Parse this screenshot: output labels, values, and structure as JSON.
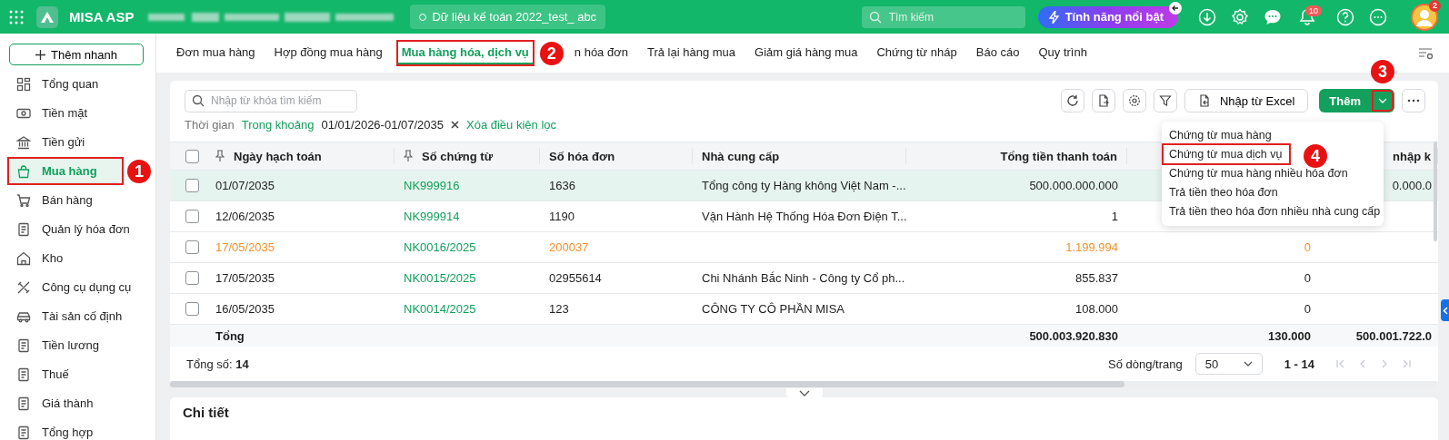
{
  "topbar": {
    "app_name": "MISA ASP",
    "database": "Dữ liệu kế toán 2022_test_ abc",
    "search": {
      "placeholder": "Tìm kiếm"
    },
    "feature_button": "Tính năng nổi bật",
    "notification_count": "10",
    "avatar_badge": "2"
  },
  "sidebar": {
    "quick_add": "Thêm nhanh",
    "items": [
      {
        "label": "Tổng quan",
        "selected": false
      },
      {
        "label": "Tiền mặt",
        "selected": false
      },
      {
        "label": "Tiền gửi",
        "selected": false
      },
      {
        "label": "Mua hàng",
        "selected": true,
        "callout": "1"
      },
      {
        "label": "Bán hàng",
        "selected": false
      },
      {
        "label": "Quản lý hóa đơn",
        "selected": false
      },
      {
        "label": "Kho",
        "selected": false
      },
      {
        "label": "Công cụ dụng cụ",
        "selected": false
      },
      {
        "label": "Tài sản cố định",
        "selected": false
      },
      {
        "label": "Tiền lương",
        "selected": false
      },
      {
        "label": "Thuế",
        "selected": false
      },
      {
        "label": "Giá thành",
        "selected": false
      },
      {
        "label": "Tổng hợp",
        "selected": false
      }
    ]
  },
  "tabs": [
    {
      "label": "Đơn mua hàng",
      "selected": false
    },
    {
      "label": "Hợp đồng mua hàng",
      "selected": false
    },
    {
      "label": "Mua hàng hóa, dịch vụ",
      "selected": true,
      "callout": "2"
    },
    {
      "label": "n hóa đơn",
      "selected": false
    },
    {
      "label": "Trả lại hàng mua",
      "selected": false
    },
    {
      "label": "Giảm giá hàng mua",
      "selected": false
    },
    {
      "label": "Chứng từ nháp",
      "selected": false
    },
    {
      "label": "Báo cáo",
      "selected": false
    },
    {
      "label": "Quy trình",
      "selected": false
    }
  ],
  "toolbar": {
    "search": {
      "placeholder": "Nhập từ khóa tìm kiếm"
    },
    "import_button": "Nhập từ Excel",
    "add_button": "Thêm",
    "add_menu_callout": "3"
  },
  "filter": {
    "label": "Thời gian",
    "mode": "Trong khoảng",
    "range": "01/01/2026-01/07/2035",
    "clear": "Xóa điều kiện lọc"
  },
  "table": {
    "all_checked": false,
    "columns": [
      {
        "label": "Ngày hạch toán",
        "pinned": true
      },
      {
        "label": "Số chứng từ",
        "pinned": true
      },
      {
        "label": "Số hóa đơn",
        "pinned": false
      },
      {
        "label": "Nhà cung cấp",
        "pinned": false
      },
      {
        "label": "Tổng tiền thanh toán",
        "pinned": false
      },
      {},
      {
        "label": "nhập k",
        "pinned": false
      }
    ],
    "rows": [
      {
        "selected": true,
        "checked": false,
        "warning": false,
        "cells": [
          "01/07/2035",
          "NK999916",
          "1636",
          "Tổng công ty Hàng không Việt Nam -...",
          "500.000.000.000",
          null,
          "0.000.0"
        ]
      },
      {
        "selected": false,
        "checked": false,
        "warning": false,
        "cells": [
          "12/06/2035",
          "NK999914",
          "1190",
          "Vận Hành Hệ Thống Hóa Đơn Điện T...",
          "1",
          null,
          null
        ]
      },
      {
        "selected": false,
        "checked": false,
        "warning": true,
        "cells": [
          "17/05/2035",
          "NK0016/2025",
          "200037",
          null,
          "1.199.994",
          "0",
          null
        ]
      },
      {
        "selected": false,
        "checked": false,
        "warning": false,
        "cells": [
          "17/05/2035",
          "NK0015/2025",
          "02955614",
          "Chi Nhánh Bắc Ninh - Công ty Cổ ph...",
          "855.837",
          "0",
          null
        ]
      },
      {
        "selected": false,
        "checked": false,
        "warning": false,
        "cells": [
          "16/05/2035",
          "NK0014/2025",
          "123",
          "CÔNG TY CÔ PHẦN MISA",
          "108.000",
          "0",
          null
        ]
      }
    ],
    "total": {
      "label": "Tổng",
      "values": [
        "500.003.920.830",
        "130.000",
        "500.001.722.0"
      ]
    }
  },
  "footer": {
    "count_label": "Tổng số:",
    "count": "14",
    "page_size_label": "Số dòng/trang",
    "page_size": "50",
    "range": "1 - 14"
  },
  "add_menu": {
    "items": [
      {
        "label": "Chứng từ mua hàng",
        "selected": false
      },
      {
        "label": "Chứng từ mua dịch vụ",
        "selected": true,
        "callout": "4"
      },
      {
        "label": "Chứng từ mua hàng nhiều hóa đơn",
        "selected": false
      },
      {
        "label": "Trả tiền theo hóa đơn",
        "selected": false
      },
      {
        "label": "Trả tiền theo hóa đơn nhiều nhà cung cấp",
        "selected": false
      }
    ]
  },
  "detail": {
    "title": "Chi tiết"
  }
}
